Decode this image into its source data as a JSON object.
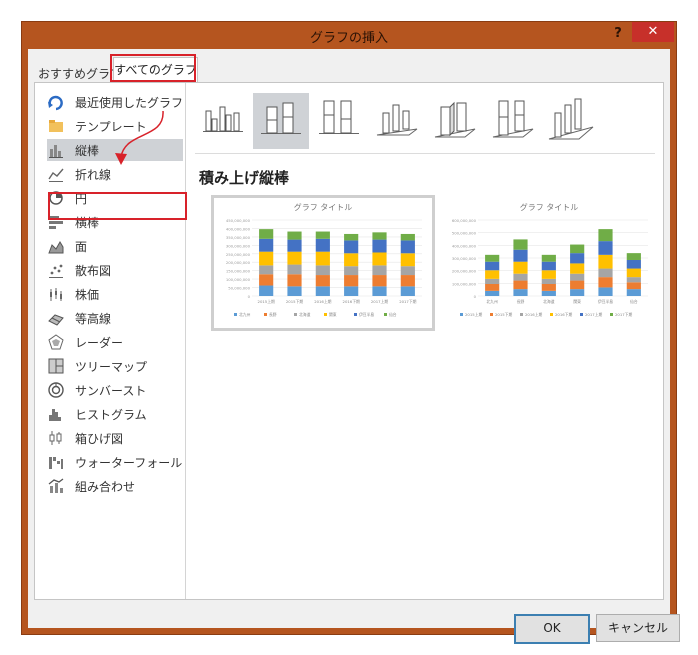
{
  "window": {
    "title": "グラフの挿入",
    "help": "?",
    "close": "✕"
  },
  "tabs": {
    "recommended": "おすすめグラフ",
    "all": "すべてのグラフ"
  },
  "sidebar": {
    "items": [
      {
        "label": "最近使用したグラフ",
        "icon": "recent-icon"
      },
      {
        "label": "テンプレート",
        "icon": "folder-icon"
      },
      {
        "label": "縦棒",
        "icon": "column-chart-icon"
      },
      {
        "label": "折れ線",
        "icon": "line-chart-icon"
      },
      {
        "label": "円",
        "icon": "pie-chart-icon"
      },
      {
        "label": "横棒",
        "icon": "bar-chart-icon"
      },
      {
        "label": "面",
        "icon": "area-chart-icon"
      },
      {
        "label": "散布図",
        "icon": "scatter-chart-icon"
      },
      {
        "label": "株価",
        "icon": "stock-chart-icon"
      },
      {
        "label": "等高線",
        "icon": "surface-chart-icon"
      },
      {
        "label": "レーダー",
        "icon": "radar-chart-icon"
      },
      {
        "label": "ツリーマップ",
        "icon": "treemap-icon"
      },
      {
        "label": "サンバースト",
        "icon": "sunburst-icon"
      },
      {
        "label": "ヒストグラム",
        "icon": "histogram-icon"
      },
      {
        "label": "箱ひげ図",
        "icon": "box-whisker-icon"
      },
      {
        "label": "ウォーターフォール",
        "icon": "waterfall-icon"
      },
      {
        "label": "組み合わせ",
        "icon": "combo-chart-icon"
      }
    ],
    "selected_index": 2
  },
  "subtype": {
    "title": "積み上げ縦棒",
    "selected_index": 1
  },
  "colors": {
    "blue": "#5b9bd5",
    "orange": "#ed7d31",
    "gray": "#a5a5a5",
    "yellow": "#ffc000",
    "darkblue": "#4472c4",
    "green": "#70ad47",
    "highlight": "#d8222a",
    "selection": "#cfd2d6"
  },
  "chart_data": [
    {
      "type": "bar",
      "stacked": true,
      "title": "グラフ タイトル",
      "categories": [
        "2015上期",
        "2015下期",
        "2016上期",
        "2016下期",
        "2017上期",
        "2017下期"
      ],
      "series": [
        {
          "name": "北九州",
          "values": [
            65,
            60,
            60,
            60,
            60,
            60
          ]
        },
        {
          "name": "長野",
          "values": [
            70,
            75,
            70,
            70,
            70,
            70
          ]
        },
        {
          "name": "北海道",
          "values": [
            55,
            60,
            60,
            55,
            60,
            55
          ]
        },
        {
          "name": "関東",
          "values": [
            85,
            80,
            85,
            80,
            80,
            80
          ]
        },
        {
          "name": "伊豆半島",
          "values": [
            80,
            75,
            80,
            80,
            80,
            80
          ]
        },
        {
          "name": "仙台",
          "values": [
            60,
            50,
            45,
            40,
            45,
            40
          ]
        }
      ],
      "ylim": [
        0,
        450000000
      ],
      "yticks": [
        "450,000,000",
        "400,000,000",
        "350,000,000",
        "300,000,000",
        "250,000,000",
        "200,000,000",
        "150,000,000",
        "100,000,000",
        "50,000,000",
        "0"
      ]
    },
    {
      "type": "bar",
      "stacked": true,
      "title": "グラフ タイトル",
      "categories": [
        "北九州",
        "長野",
        "北海道",
        "関東",
        "伊豆半島",
        "仙台"
      ],
      "series": [
        {
          "name": "2015上期",
          "values": [
            15,
            20,
            15,
            20,
            25,
            20
          ]
        },
        {
          "name": "2015下期",
          "values": [
            20,
            25,
            20,
            25,
            30,
            20
          ]
        },
        {
          "name": "2016上期",
          "values": [
            15,
            20,
            15,
            20,
            25,
            15
          ]
        },
        {
          "name": "2016下期",
          "values": [
            25,
            35,
            25,
            30,
            40,
            25
          ]
        },
        {
          "name": "2017上期",
          "values": [
            25,
            35,
            25,
            30,
            40,
            25
          ]
        },
        {
          "name": "2017下期",
          "values": [
            20,
            30,
            20,
            25,
            35,
            20
          ]
        }
      ],
      "ylim": [
        0,
        600000000
      ],
      "yticks": [
        "600,000,000",
        "500,000,000",
        "400,000,000",
        "300,000,000",
        "200,000,000",
        "100,000,000",
        "0"
      ]
    }
  ],
  "buttons": {
    "ok": "OK",
    "cancel": "キャンセル"
  }
}
